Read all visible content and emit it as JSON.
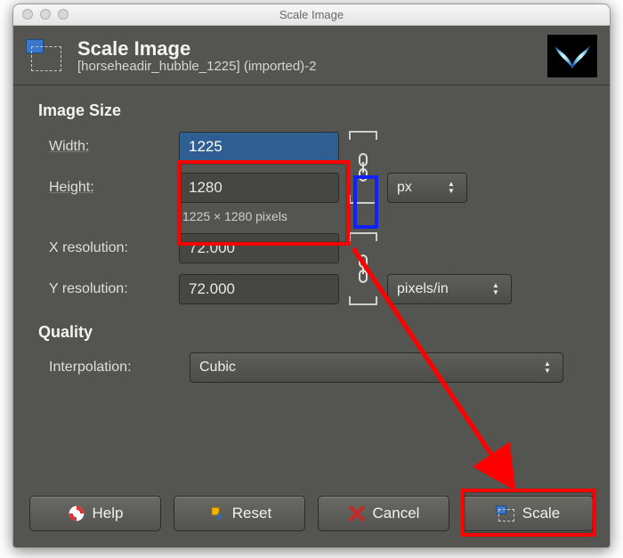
{
  "titlebar": {
    "title": "Scale Image"
  },
  "header": {
    "title": "Scale Image",
    "subtitle": "[horseheadir_hubble_1225] (imported)-2"
  },
  "image_size": {
    "section_label": "Image Size",
    "width_label": "Width:",
    "width_value": "1225",
    "height_label": "Height:",
    "height_value": "1280",
    "unit_value": "px",
    "pixel_info": "1225 × 1280 pixels",
    "xres_label": "X resolution:",
    "xres_value": "72.000",
    "yres_label": "Y resolution:",
    "yres_value": "72.000",
    "res_unit_value": "pixels/in"
  },
  "quality": {
    "section_label": "Quality",
    "interp_label": "Interpolation:",
    "interp_value": "Cubic"
  },
  "buttons": {
    "help": "Help",
    "reset": "Reset",
    "cancel": "Cancel",
    "scale": "Scale"
  }
}
